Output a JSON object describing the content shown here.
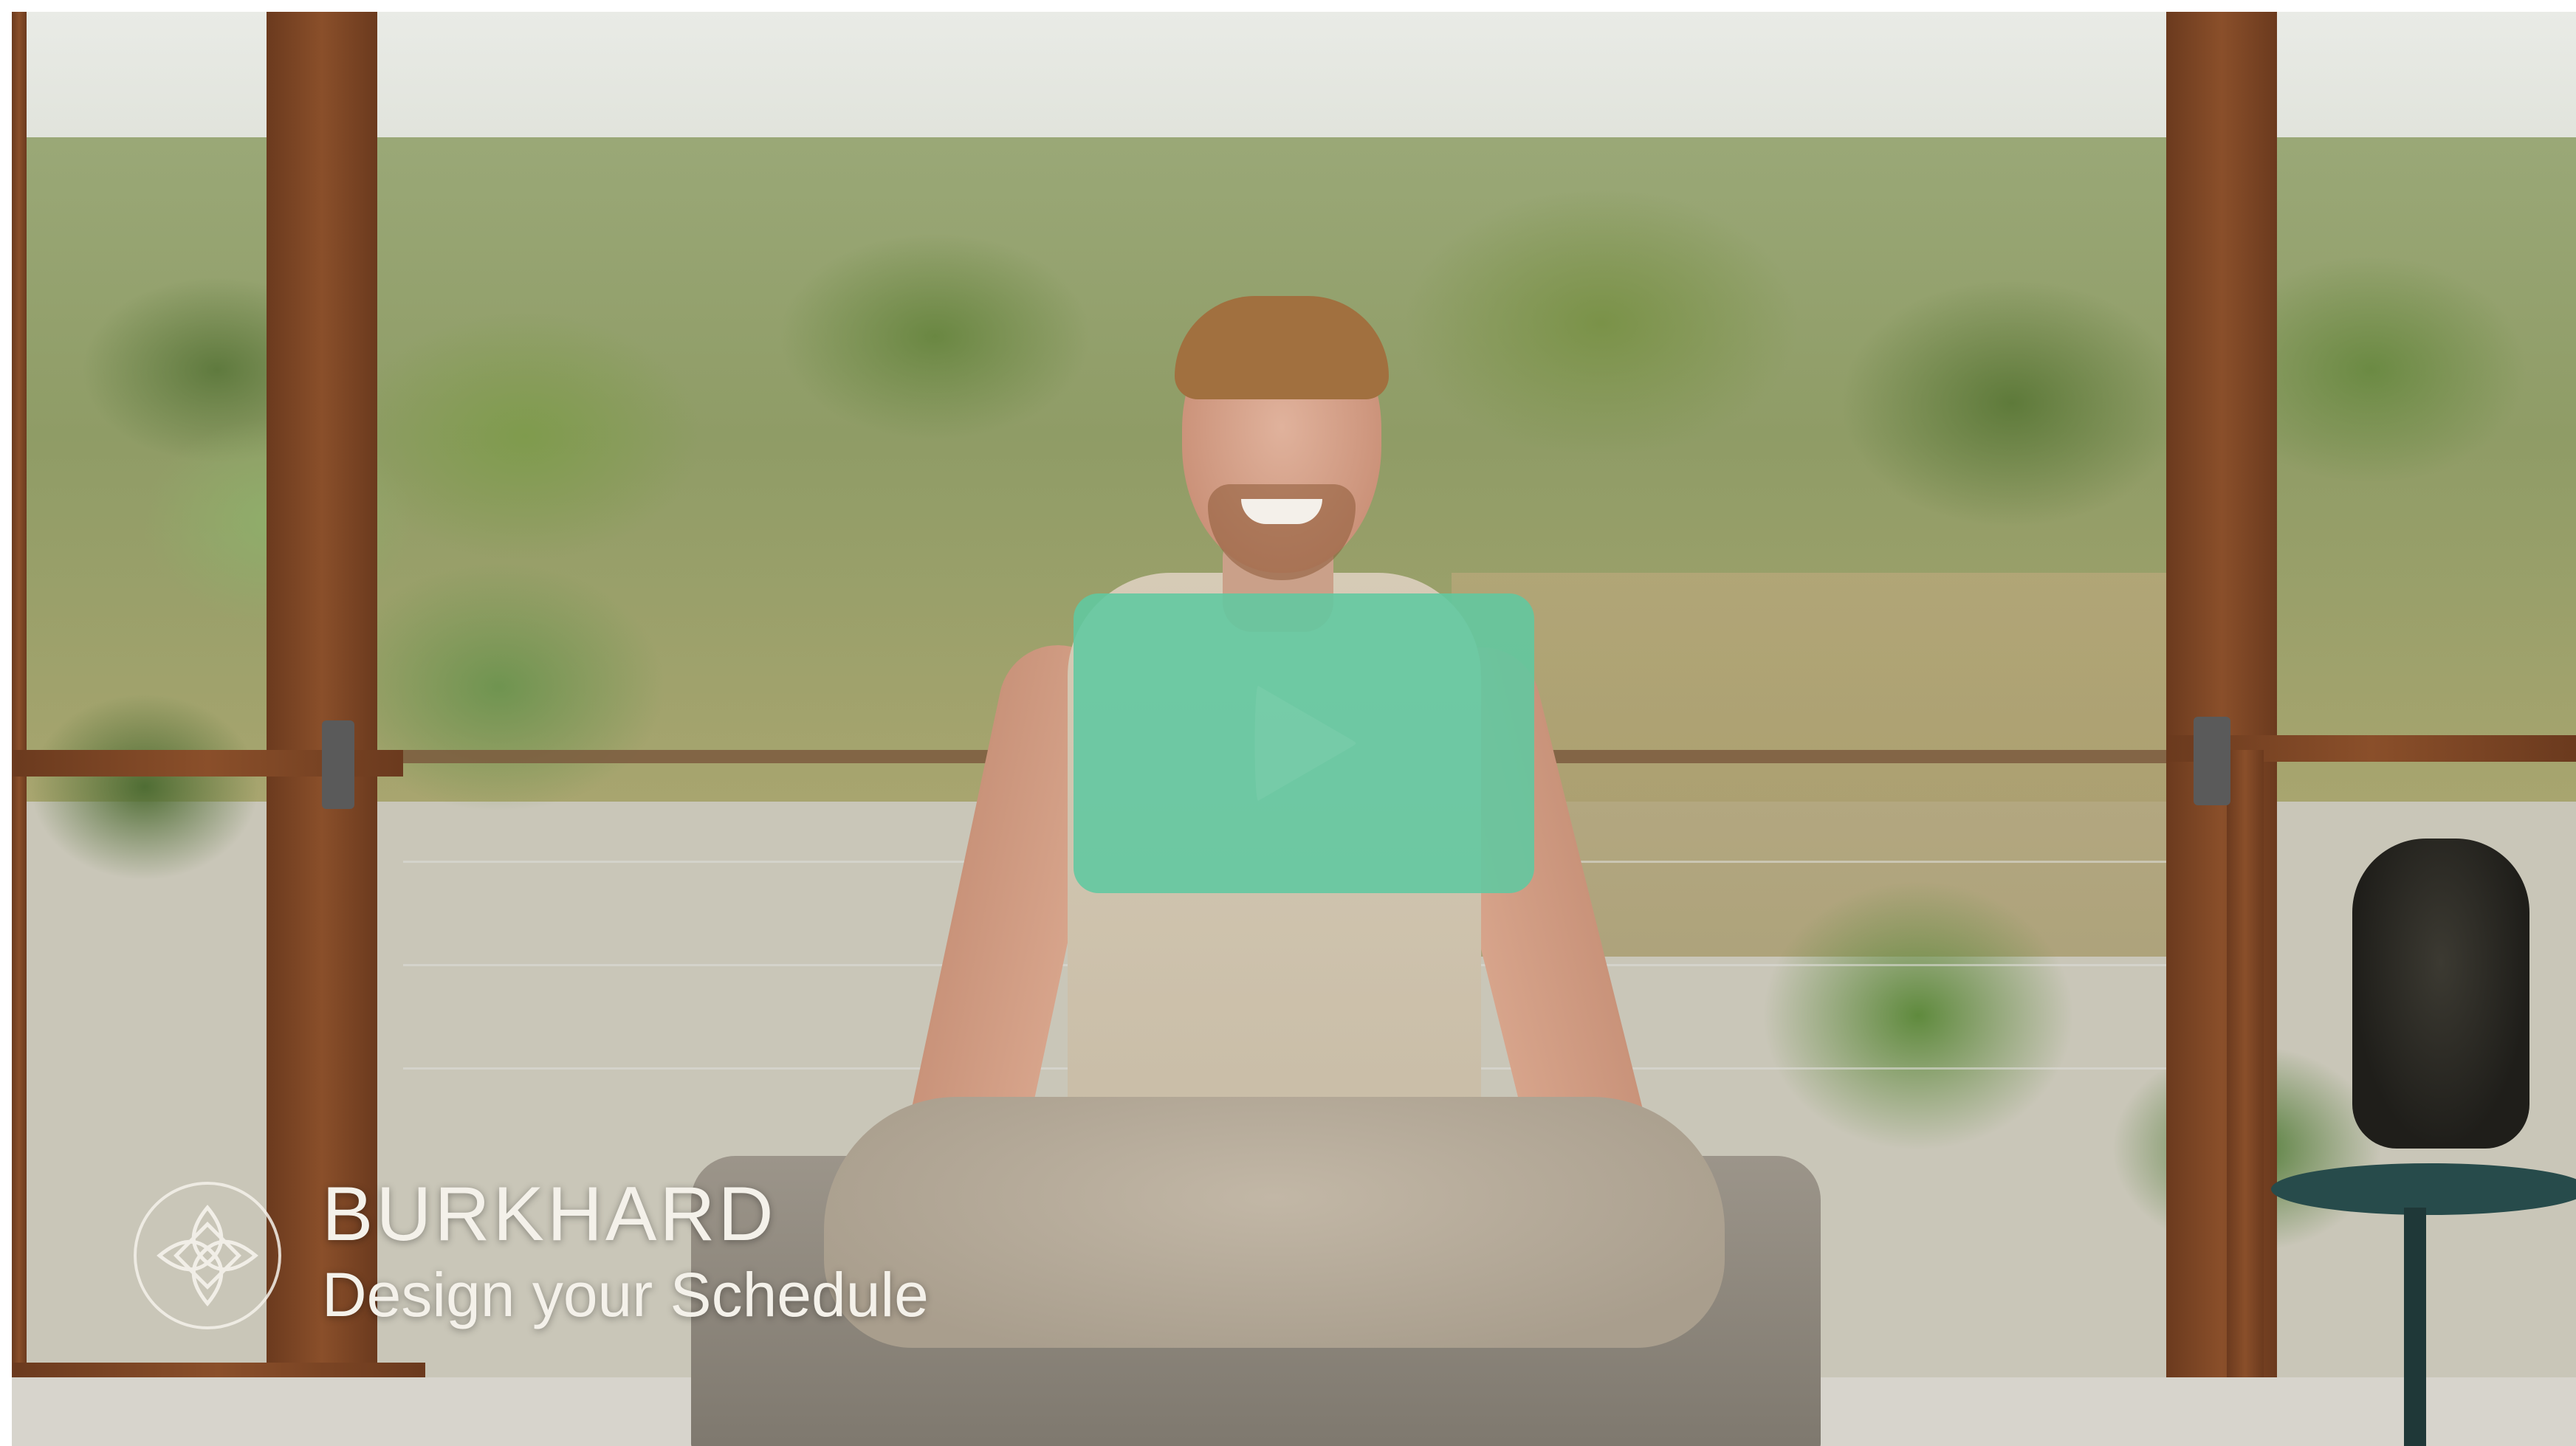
{
  "video": {
    "brand_name": "BURKHARD",
    "subtitle": "Design your Schedule",
    "play_icon": "play-icon",
    "logo_icon": "lotus-icon",
    "accent_color": "#60c8a0"
  }
}
